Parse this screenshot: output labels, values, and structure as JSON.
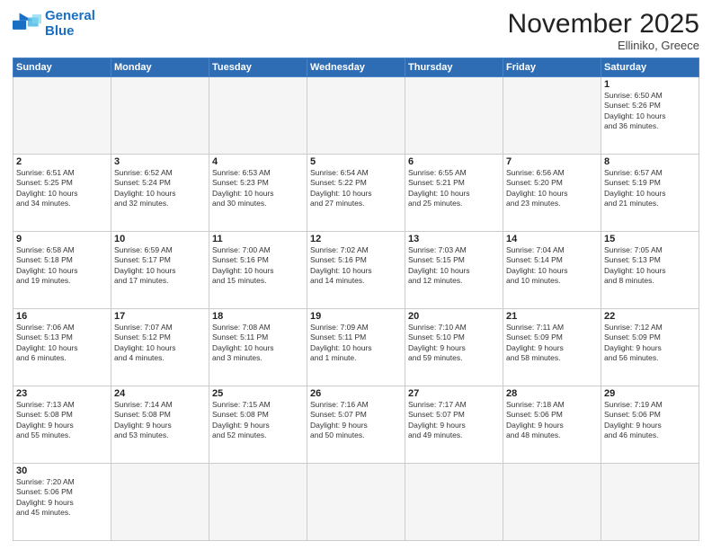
{
  "header": {
    "logo_general": "General",
    "logo_blue": "Blue",
    "title": "November 2025",
    "location": "Elliniko, Greece"
  },
  "days_of_week": [
    "Sunday",
    "Monday",
    "Tuesday",
    "Wednesday",
    "Thursday",
    "Friday",
    "Saturday"
  ],
  "weeks": [
    [
      {
        "day": "",
        "info": ""
      },
      {
        "day": "",
        "info": ""
      },
      {
        "day": "",
        "info": ""
      },
      {
        "day": "",
        "info": ""
      },
      {
        "day": "",
        "info": ""
      },
      {
        "day": "",
        "info": ""
      },
      {
        "day": "1",
        "info": "Sunrise: 6:50 AM\nSunset: 5:26 PM\nDaylight: 10 hours\nand 36 minutes."
      }
    ],
    [
      {
        "day": "2",
        "info": "Sunrise: 6:51 AM\nSunset: 5:25 PM\nDaylight: 10 hours\nand 34 minutes."
      },
      {
        "day": "3",
        "info": "Sunrise: 6:52 AM\nSunset: 5:24 PM\nDaylight: 10 hours\nand 32 minutes."
      },
      {
        "day": "4",
        "info": "Sunrise: 6:53 AM\nSunset: 5:23 PM\nDaylight: 10 hours\nand 30 minutes."
      },
      {
        "day": "5",
        "info": "Sunrise: 6:54 AM\nSunset: 5:22 PM\nDaylight: 10 hours\nand 27 minutes."
      },
      {
        "day": "6",
        "info": "Sunrise: 6:55 AM\nSunset: 5:21 PM\nDaylight: 10 hours\nand 25 minutes."
      },
      {
        "day": "7",
        "info": "Sunrise: 6:56 AM\nSunset: 5:20 PM\nDaylight: 10 hours\nand 23 minutes."
      },
      {
        "day": "8",
        "info": "Sunrise: 6:57 AM\nSunset: 5:19 PM\nDaylight: 10 hours\nand 21 minutes."
      }
    ],
    [
      {
        "day": "9",
        "info": "Sunrise: 6:58 AM\nSunset: 5:18 PM\nDaylight: 10 hours\nand 19 minutes."
      },
      {
        "day": "10",
        "info": "Sunrise: 6:59 AM\nSunset: 5:17 PM\nDaylight: 10 hours\nand 17 minutes."
      },
      {
        "day": "11",
        "info": "Sunrise: 7:00 AM\nSunset: 5:16 PM\nDaylight: 10 hours\nand 15 minutes."
      },
      {
        "day": "12",
        "info": "Sunrise: 7:02 AM\nSunset: 5:16 PM\nDaylight: 10 hours\nand 14 minutes."
      },
      {
        "day": "13",
        "info": "Sunrise: 7:03 AM\nSunset: 5:15 PM\nDaylight: 10 hours\nand 12 minutes."
      },
      {
        "day": "14",
        "info": "Sunrise: 7:04 AM\nSunset: 5:14 PM\nDaylight: 10 hours\nand 10 minutes."
      },
      {
        "day": "15",
        "info": "Sunrise: 7:05 AM\nSunset: 5:13 PM\nDaylight: 10 hours\nand 8 minutes."
      }
    ],
    [
      {
        "day": "16",
        "info": "Sunrise: 7:06 AM\nSunset: 5:13 PM\nDaylight: 10 hours\nand 6 minutes."
      },
      {
        "day": "17",
        "info": "Sunrise: 7:07 AM\nSunset: 5:12 PM\nDaylight: 10 hours\nand 4 minutes."
      },
      {
        "day": "18",
        "info": "Sunrise: 7:08 AM\nSunset: 5:11 PM\nDaylight: 10 hours\nand 3 minutes."
      },
      {
        "day": "19",
        "info": "Sunrise: 7:09 AM\nSunset: 5:11 PM\nDaylight: 10 hours\nand 1 minute."
      },
      {
        "day": "20",
        "info": "Sunrise: 7:10 AM\nSunset: 5:10 PM\nDaylight: 9 hours\nand 59 minutes."
      },
      {
        "day": "21",
        "info": "Sunrise: 7:11 AM\nSunset: 5:09 PM\nDaylight: 9 hours\nand 58 minutes."
      },
      {
        "day": "22",
        "info": "Sunrise: 7:12 AM\nSunset: 5:09 PM\nDaylight: 9 hours\nand 56 minutes."
      }
    ],
    [
      {
        "day": "23",
        "info": "Sunrise: 7:13 AM\nSunset: 5:08 PM\nDaylight: 9 hours\nand 55 minutes."
      },
      {
        "day": "24",
        "info": "Sunrise: 7:14 AM\nSunset: 5:08 PM\nDaylight: 9 hours\nand 53 minutes."
      },
      {
        "day": "25",
        "info": "Sunrise: 7:15 AM\nSunset: 5:08 PM\nDaylight: 9 hours\nand 52 minutes."
      },
      {
        "day": "26",
        "info": "Sunrise: 7:16 AM\nSunset: 5:07 PM\nDaylight: 9 hours\nand 50 minutes."
      },
      {
        "day": "27",
        "info": "Sunrise: 7:17 AM\nSunset: 5:07 PM\nDaylight: 9 hours\nand 49 minutes."
      },
      {
        "day": "28",
        "info": "Sunrise: 7:18 AM\nSunset: 5:06 PM\nDaylight: 9 hours\nand 48 minutes."
      },
      {
        "day": "29",
        "info": "Sunrise: 7:19 AM\nSunset: 5:06 PM\nDaylight: 9 hours\nand 46 minutes."
      }
    ],
    [
      {
        "day": "30",
        "info": "Sunrise: 7:20 AM\nSunset: 5:06 PM\nDaylight: 9 hours\nand 45 minutes."
      },
      {
        "day": "",
        "info": ""
      },
      {
        "day": "",
        "info": ""
      },
      {
        "day": "",
        "info": ""
      },
      {
        "day": "",
        "info": ""
      },
      {
        "day": "",
        "info": ""
      },
      {
        "day": "",
        "info": ""
      }
    ]
  ]
}
